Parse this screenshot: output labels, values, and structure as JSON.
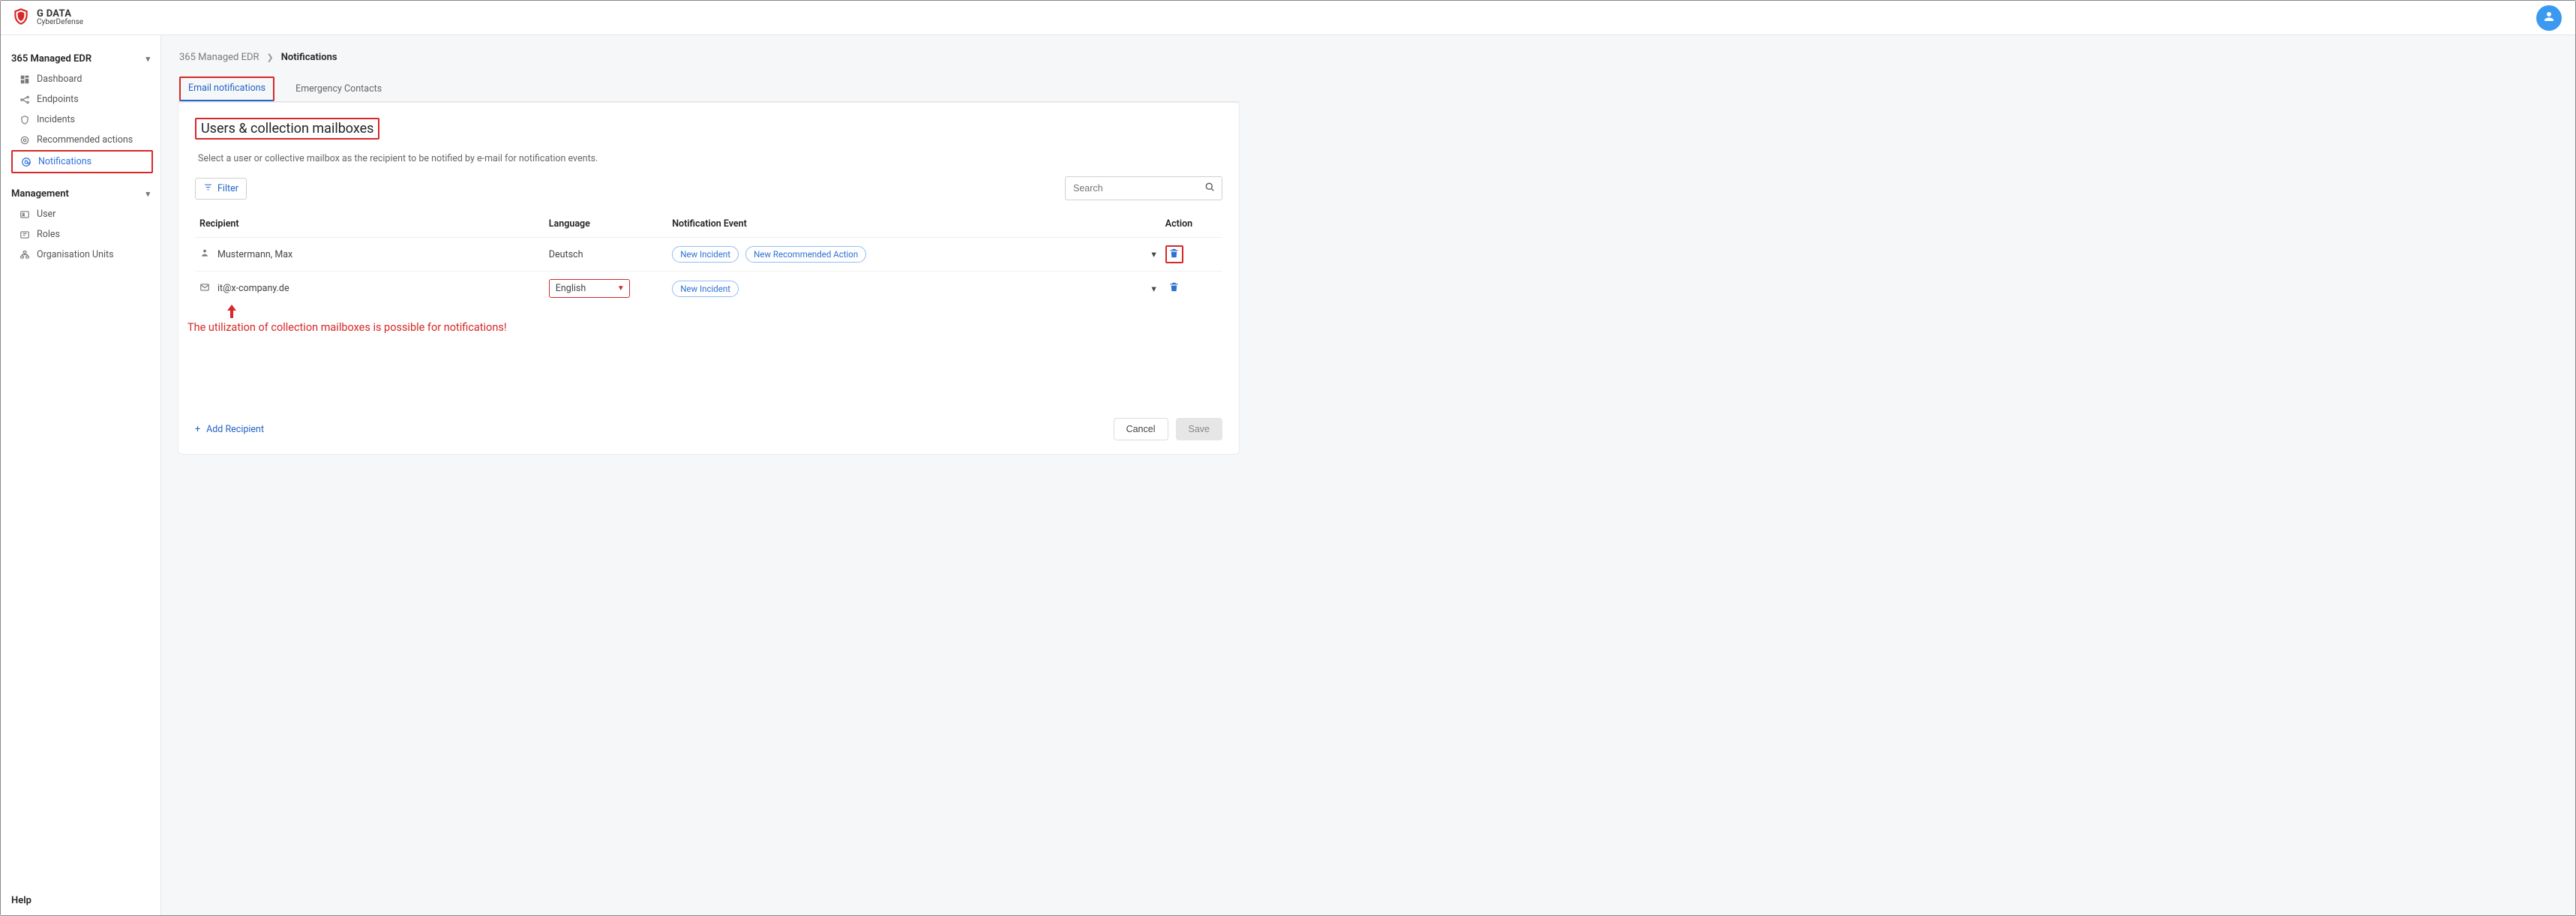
{
  "brand": {
    "name": "G DATA",
    "sub": "CyberDefense"
  },
  "sidebar": {
    "section1": {
      "title": "365 Managed EDR"
    },
    "items1": [
      {
        "label": "Dashboard"
      },
      {
        "label": "Endpoints"
      },
      {
        "label": "Incidents"
      },
      {
        "label": "Recommended actions"
      },
      {
        "label": "Notifications"
      }
    ],
    "section2": {
      "title": "Management"
    },
    "items2": [
      {
        "label": "User"
      },
      {
        "label": "Roles"
      },
      {
        "label": "Organisation Units"
      }
    ],
    "help": "Help"
  },
  "breadcrumb": {
    "root": "365 Managed EDR",
    "current": "Notifications"
  },
  "tabs": [
    {
      "label": "Email notifications"
    },
    {
      "label": "Emergency Contacts"
    }
  ],
  "card": {
    "title": "Users & collection mailboxes",
    "sub": "Select a user or collective mailbox as the recipient to be notified by e-mail for notification events.",
    "filter": "Filter",
    "search_placeholder": "Search",
    "headers": {
      "recipient": "Recipient",
      "language": "Language",
      "event": "Notification Event",
      "action": "Action"
    },
    "rows": [
      {
        "icon": "person",
        "name": "Mustermann, Max",
        "lang": "Deutsch",
        "chips": [
          "New Incident",
          "New Recommended Action"
        ]
      },
      {
        "icon": "mail",
        "name": "it@x-company.de",
        "lang": "English",
        "chips": [
          "New Incident"
        ]
      }
    ],
    "add": "Add Recipient",
    "cancel": "Cancel",
    "save": "Save"
  },
  "annotation": "The utilization of collection mailboxes is possible for notifications!"
}
